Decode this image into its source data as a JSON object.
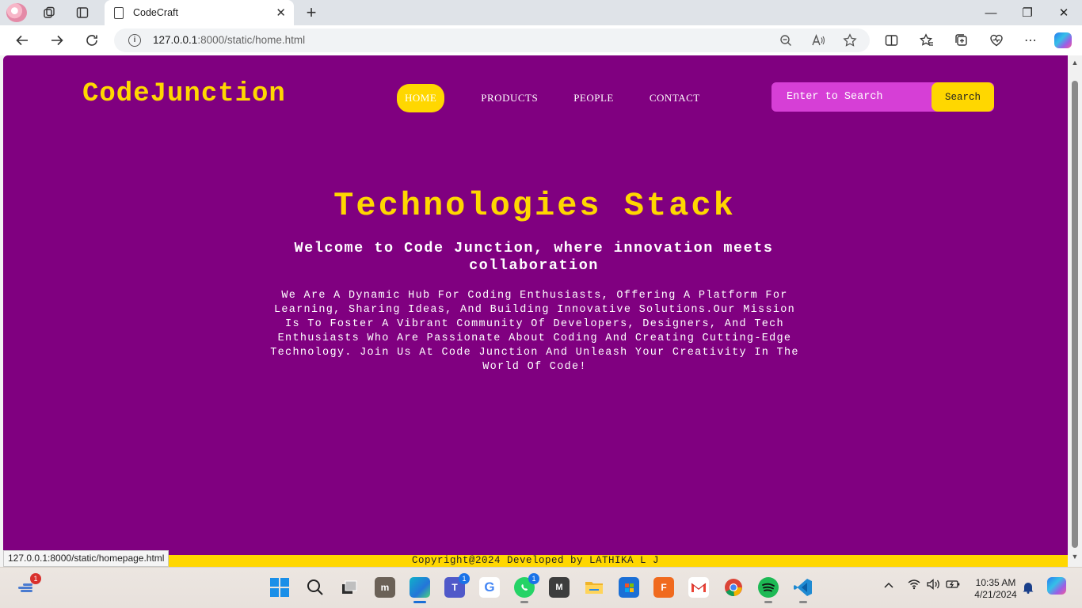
{
  "browser": {
    "tab_title": "CodeCraft",
    "tab_close": "✕",
    "new_tab": "+",
    "url_host": "127.0.0.1",
    "url_rest": ":8000/static/home.html",
    "status_url": "127.0.0.1:8000/static/homepage.html",
    "window_controls": {
      "minimize": "—",
      "maximize": "❐",
      "close": "✕"
    }
  },
  "site": {
    "logo": "CodeJunction",
    "nav": [
      {
        "label": "HOME"
      },
      {
        "label": "PRODUCTS"
      },
      {
        "label": "PEOPLE"
      },
      {
        "label": "CONTACT"
      }
    ],
    "search": {
      "placeholder": "Enter to Search",
      "button": "Search"
    },
    "hero": {
      "title": "Technologies Stack",
      "subtitle": "Welcome to Code Junction, where innovation meets collaboration",
      "description": "We Are A Dynamic Hub For Coding Enthusiasts, Offering A Platform For Learning, Sharing Ideas, And Building Innovative Solutions.Our Mission Is To Foster A Vibrant Community Of Developers, Designers, And Tech Enthusiasts Who Are Passionate About Coding And Creating Cutting-Edge Technology. Join Us At Code Junction And Unleash Your Creativity In The World Of Code!"
    },
    "footer": "Copyright@2024 Developed by LATHIKA L J"
  },
  "taskbar": {
    "widgets_badge": "1",
    "teams_badge": "1",
    "whatsapp_badge": "1",
    "clock_time": "10:35 AM",
    "clock_date": "4/21/2024"
  },
  "colors": {
    "page_bg": "#800080",
    "accent": "#ffd700",
    "search_bg": "#d63fd6"
  }
}
